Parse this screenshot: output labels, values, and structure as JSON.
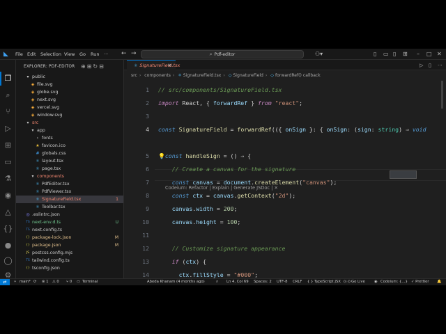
{
  "titlebar": {
    "menus": [
      "File",
      "Edit",
      "Selection",
      "View",
      "Go",
      "Run"
    ],
    "more": "···",
    "back": "←",
    "forward": "→",
    "search": "Pdf-editor"
  },
  "activity": {
    "icons": [
      "files-icon",
      "search-icon",
      "source-control-icon",
      "run-debug-icon",
      "extensions-icon",
      "remote-icon",
      "testing-icon",
      "codeium-icon",
      "drive-icon",
      "bracket-icon",
      "json-icon",
      "account-icon",
      "settings-icon"
    ]
  },
  "explorer": {
    "header": "EXPLORER: PDF-EDITOR",
    "items": [
      {
        "d": 1,
        "label": "public",
        "kind": "folder-open",
        "state": ""
      },
      {
        "d": 2,
        "label": "file.svg",
        "kind": "svg",
        "state": ""
      },
      {
        "d": 2,
        "label": "globe.svg",
        "kind": "svg",
        "state": ""
      },
      {
        "d": 2,
        "label": "next.svg",
        "kind": "svg",
        "state": ""
      },
      {
        "d": 2,
        "label": "vercel.svg",
        "kind": "svg",
        "state": ""
      },
      {
        "d": 2,
        "label": "window.svg",
        "kind": "svg",
        "state": ""
      },
      {
        "d": 1,
        "label": "src",
        "kind": "folder-open",
        "state": "err"
      },
      {
        "d": 2,
        "label": "app",
        "kind": "folder-open",
        "state": ""
      },
      {
        "d": 3,
        "label": "fonts",
        "kind": "folder",
        "state": ""
      },
      {
        "d": 3,
        "label": "favicon.ico",
        "kind": "star",
        "state": ""
      },
      {
        "d": 3,
        "label": "globals.css",
        "kind": "css",
        "state": ""
      },
      {
        "d": 3,
        "label": "layout.tsx",
        "kind": "tsx",
        "state": ""
      },
      {
        "d": 3,
        "label": "page.tsx",
        "kind": "tsx",
        "state": ""
      },
      {
        "d": 2,
        "label": "components",
        "kind": "folder-open",
        "state": "err"
      },
      {
        "d": 3,
        "label": "PdfEditor.tsx",
        "kind": "tsx",
        "state": ""
      },
      {
        "d": 3,
        "label": "PdfViewer.tsx",
        "kind": "tsx",
        "state": ""
      },
      {
        "d": 3,
        "label": "SignatureField.tsx",
        "kind": "tsx",
        "state": "err",
        "mark": "1",
        "sel": true
      },
      {
        "d": 3,
        "label": "Toolbar.tsx",
        "kind": "tsx",
        "state": ""
      },
      {
        "d": 1,
        "label": ".eslintrc.json",
        "kind": "eslint",
        "state": ""
      },
      {
        "d": 1,
        "label": "next-env.d.ts",
        "kind": "ts",
        "state": "untr",
        "mark": "U"
      },
      {
        "d": 1,
        "label": "next.config.ts",
        "kind": "ts",
        "state": ""
      },
      {
        "d": 1,
        "label": "package-lock.json",
        "kind": "json",
        "state": "mod",
        "mark": "M"
      },
      {
        "d": 1,
        "label": "package.json",
        "kind": "json",
        "state": "mod",
        "mark": "M"
      },
      {
        "d": 1,
        "label": "postcss.config.mjs",
        "kind": "js",
        "state": ""
      },
      {
        "d": 1,
        "label": "tailwind.config.ts",
        "kind": "ts",
        "state": ""
      },
      {
        "d": 1,
        "label": "tsconfig.json",
        "kind": "json",
        "state": ""
      }
    ]
  },
  "editor": {
    "tab": "SignatureField.tsx",
    "tab_badge": "1",
    "breadcrumb": [
      "src",
      "components",
      "SignatureField.tsx",
      "SignatureField",
      "forwardRef() callback"
    ],
    "codelens": "Codeium: Refactor | Explain | Generate JSDoc | ✕",
    "lines": [
      {
        "n": "1",
        "t": [
          [
            "cm",
            "// src/components/SignatureField.tsx"
          ]
        ]
      },
      {
        "n": "2",
        "t": [
          [
            "kw2",
            "import"
          ],
          [
            "pl",
            " React, { "
          ],
          [
            "vr",
            "forwardRef"
          ],
          [
            "pl",
            " } "
          ],
          [
            "kw2",
            "from"
          ],
          [
            "pl",
            " "
          ],
          [
            "st",
            "\"react\""
          ],
          [
            "pl",
            ";"
          ]
        ]
      },
      {
        "n": "3",
        "t": []
      },
      {
        "n": "4",
        "t": [
          [
            "kw",
            "const"
          ],
          [
            "pl",
            " "
          ],
          [
            "fn",
            "SignatureField"
          ],
          [
            "pl",
            " = "
          ],
          [
            "fn",
            "forwardRef"
          ],
          [
            "pl",
            "(({ "
          ],
          [
            "vr",
            "onSign"
          ],
          [
            "pl",
            " }: { "
          ],
          [
            "vr",
            "onSign"
          ],
          [
            "pl",
            ": ("
          ],
          [
            "vr",
            "sign"
          ],
          [
            "pl",
            ": "
          ],
          [
            "ty",
            "string"
          ],
          [
            "pl",
            ") ⇒ "
          ],
          [
            "kw",
            "void"
          ]
        ]
      },
      {
        "n": "5",
        "t": [
          [
            "pl",
            "  "
          ],
          [
            "kw",
            "const"
          ],
          [
            "pl",
            " "
          ],
          [
            "fn",
            "handleSign"
          ],
          [
            "pl",
            " = () ⇒ {"
          ]
        ]
      },
      {
        "n": "6",
        "t": [
          [
            "pl",
            "    "
          ],
          [
            "cm",
            "// Create a canvas for the signature"
          ]
        ]
      },
      {
        "n": "7",
        "t": [
          [
            "pl",
            "    "
          ],
          [
            "kw",
            "const"
          ],
          [
            "pl",
            " "
          ],
          [
            "vr",
            "canvas"
          ],
          [
            "pl",
            " = "
          ],
          [
            "vr",
            "document"
          ],
          [
            "pl",
            "."
          ],
          [
            "fn",
            "createElement"
          ],
          [
            "pl",
            "("
          ],
          [
            "st",
            "\"canvas\""
          ],
          [
            "pl",
            ");"
          ]
        ]
      },
      {
        "n": "8",
        "t": [
          [
            "pl",
            "    "
          ],
          [
            "kw",
            "const"
          ],
          [
            "pl",
            " "
          ],
          [
            "vr",
            "ctx"
          ],
          [
            "pl",
            " = "
          ],
          [
            "vr",
            "canvas"
          ],
          [
            "pl",
            "."
          ],
          [
            "fn",
            "getContext"
          ],
          [
            "pl",
            "("
          ],
          [
            "st",
            "\"2d\""
          ],
          [
            "pl",
            ");"
          ]
        ]
      },
      {
        "n": "9",
        "t": [
          [
            "pl",
            "    "
          ],
          [
            "vr",
            "canvas"
          ],
          [
            "pl",
            "."
          ],
          [
            "vr",
            "width"
          ],
          [
            "pl",
            " = "
          ],
          [
            "nm",
            "200"
          ],
          [
            "pl",
            ";"
          ]
        ]
      },
      {
        "n": "10",
        "t": [
          [
            "pl",
            "    "
          ],
          [
            "vr",
            "canvas"
          ],
          [
            "pl",
            "."
          ],
          [
            "vr",
            "height"
          ],
          [
            "pl",
            " = "
          ],
          [
            "nm",
            "100"
          ],
          [
            "pl",
            ";"
          ]
        ]
      },
      {
        "n": "11",
        "t": []
      },
      {
        "n": "12",
        "t": [
          [
            "pl",
            "    "
          ],
          [
            "cm",
            "// Customize signature appearance"
          ]
        ]
      },
      {
        "n": "13",
        "t": [
          [
            "pl",
            "    "
          ],
          [
            "kw2",
            "if"
          ],
          [
            "pl",
            " ("
          ],
          [
            "vr",
            "ctx"
          ],
          [
            "pl",
            ") {"
          ]
        ]
      },
      {
        "n": "14",
        "t": [
          [
            "pl",
            "      "
          ],
          [
            "vr",
            "ctx"
          ],
          [
            "pl",
            "."
          ],
          [
            "vr",
            "fillStyle"
          ],
          [
            "pl",
            " = "
          ],
          [
            "st",
            "\"#000\""
          ],
          [
            "pl",
            ";"
          ]
        ]
      }
    ]
  },
  "status": {
    "branch": "main*",
    "sync": "⟳",
    "errors": "⊗ 1",
    "warnings": "⚠ 0",
    "ports": "⑂ 0",
    "terminal": "Terminal",
    "blame": "Abeda Khanam (4 months ago)",
    "position": "Ln 4, Col 69",
    "spaces": "Spaces: 2",
    "encoding": "UTF-8",
    "eol": "CRLF",
    "lang": "{ } TypeScript JSX",
    "golive": "Go Live",
    "codeium": "Codeium: {...}",
    "prettier": "✓ Prettier",
    "bell": "🔔"
  }
}
